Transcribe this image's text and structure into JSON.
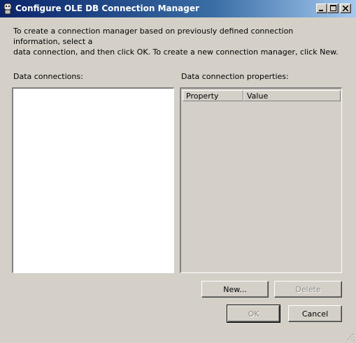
{
  "window": {
    "title": "Configure OLE DB Connection Manager",
    "controls": {
      "minimize_icon": "minimize-icon",
      "maximize_icon": "maximize-icon",
      "close_icon": "close-icon"
    }
  },
  "intro_text": "To create a connection manager based on previously defined connection information, select a\ndata connection, and then click OK. To create a new connection manager, click New.",
  "data_connections": {
    "label": "Data connections:",
    "items": []
  },
  "properties": {
    "label": "Data connection properties:",
    "columns": [
      "Property",
      "Value"
    ],
    "rows": []
  },
  "buttons": {
    "new": "New...",
    "delete": "Delete",
    "ok": "OK",
    "cancel": "Cancel"
  },
  "colors": {
    "title_gradient_start": "#0a246a",
    "title_gradient_end": "#a6caf0",
    "dialog_face": "#d4d0c8",
    "disabled_text": "#8c8a84"
  }
}
